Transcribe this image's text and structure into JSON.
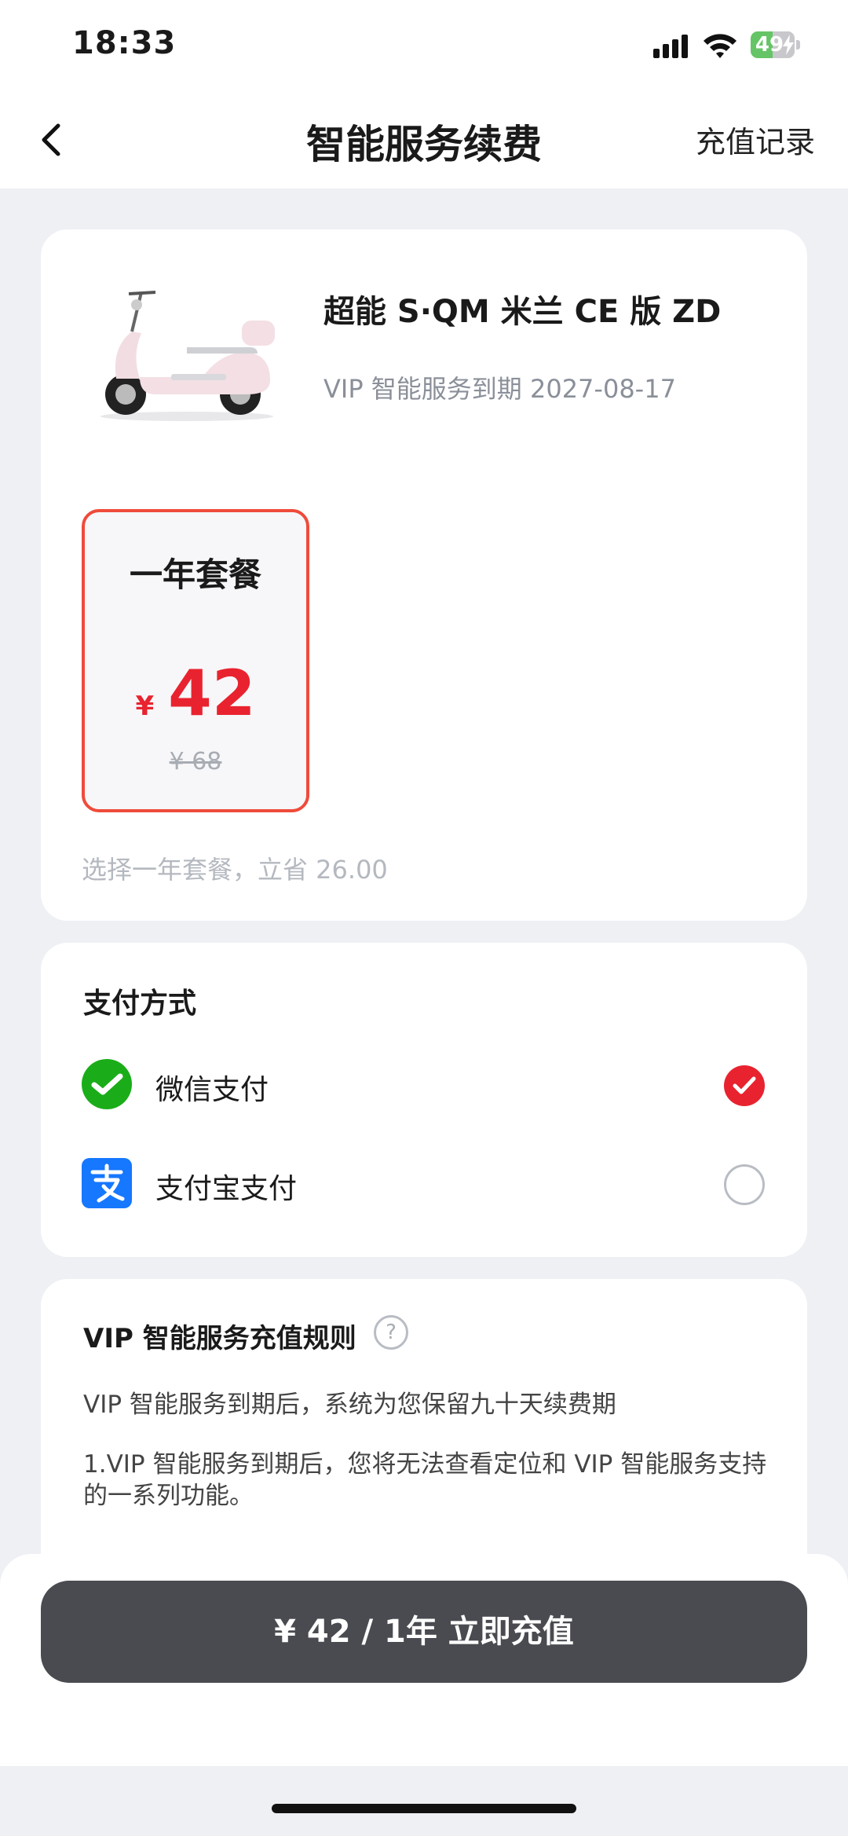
{
  "status": {
    "time": "18:33",
    "battery": "49"
  },
  "nav": {
    "title": "智能服务续费",
    "action": "充值记录"
  },
  "product": {
    "name": "超能 S·QM 米兰 CE 版 ZD",
    "expire": "VIP 智能服务到期 2027-08-17"
  },
  "plan": {
    "title": "一年套餐",
    "currency": "¥",
    "price": "42",
    "original": "¥ 68",
    "save_tip": "选择一年套餐，立省 26.00"
  },
  "payment": {
    "title": "支付方式",
    "options": [
      {
        "label": "微信支付",
        "selected": true
      },
      {
        "label": "支付宝支付",
        "selected": false
      }
    ]
  },
  "rules": {
    "title": "VIP 智能服务充值规则",
    "help": "?",
    "line1": "VIP 智能服务到期后，系统为您保留九十天续费期",
    "line2": "1.VIP 智能服务到期后，您将无法查看定位和 VIP 智能服务支持的一系列功能。"
  },
  "submit": {
    "label": "¥ 42 / 1年 立即充值"
  },
  "colors": {
    "accent_red": "#e8232f",
    "plan_border": "#ef4b3b",
    "button_dark": "#4a4b50",
    "wechat_green": "#1aad19",
    "alipay_blue": "#1677ff"
  }
}
